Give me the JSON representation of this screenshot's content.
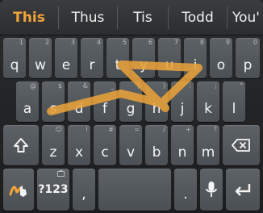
{
  "suggestions": {
    "primary": "This",
    "items": [
      "Thus",
      "Tis",
      "Todd",
      "You'"
    ]
  },
  "rows": {
    "row1": [
      {
        "label": "q",
        "hint": "1"
      },
      {
        "label": "w",
        "hint": "2"
      },
      {
        "label": "e",
        "hint": "3"
      },
      {
        "label": "r",
        "hint": "4"
      },
      {
        "label": "t",
        "hint": "5"
      },
      {
        "label": "y",
        "hint": "6"
      },
      {
        "label": "u",
        "hint": "7"
      },
      {
        "label": "i",
        "hint": "8"
      },
      {
        "label": "o",
        "hint": "9"
      },
      {
        "label": "p",
        "hint": "0"
      }
    ],
    "row2": [
      {
        "label": "a",
        "hint": "@"
      },
      {
        "label": "s",
        "hint": "$"
      },
      {
        "label": "d",
        "hint": "&"
      },
      {
        "label": "f",
        "hint": "_"
      },
      {
        "label": "g",
        "hint": "("
      },
      {
        "label": "h",
        "hint": ")"
      },
      {
        "label": "j",
        "hint": ":"
      },
      {
        "label": "k",
        "hint": ";"
      },
      {
        "label": "l",
        "hint": "\""
      }
    ],
    "row3": [
      {
        "label": "z",
        "hint": "☺"
      },
      {
        "label": "x",
        "hint": "!"
      },
      {
        "label": "c",
        "hint": "#"
      },
      {
        "label": "v",
        "hint": "="
      },
      {
        "label": "b",
        "hint": "/"
      },
      {
        "label": "n",
        "hint": "+"
      },
      {
        "label": "m",
        "hint": "?"
      }
    ]
  },
  "bottom": {
    "symbols_label": "?123",
    "comma_label": ",",
    "period_label": "."
  },
  "icons": {
    "shift": "shift-icon",
    "backspace": "backspace-icon",
    "gesture": "swype-gesture-icon",
    "mic": "microphone-icon",
    "enter": "enter-icon"
  },
  "colors": {
    "accent": "#f2a43a",
    "trail": "#e8a23a",
    "key": "#54595d",
    "background": "#1e2022"
  }
}
